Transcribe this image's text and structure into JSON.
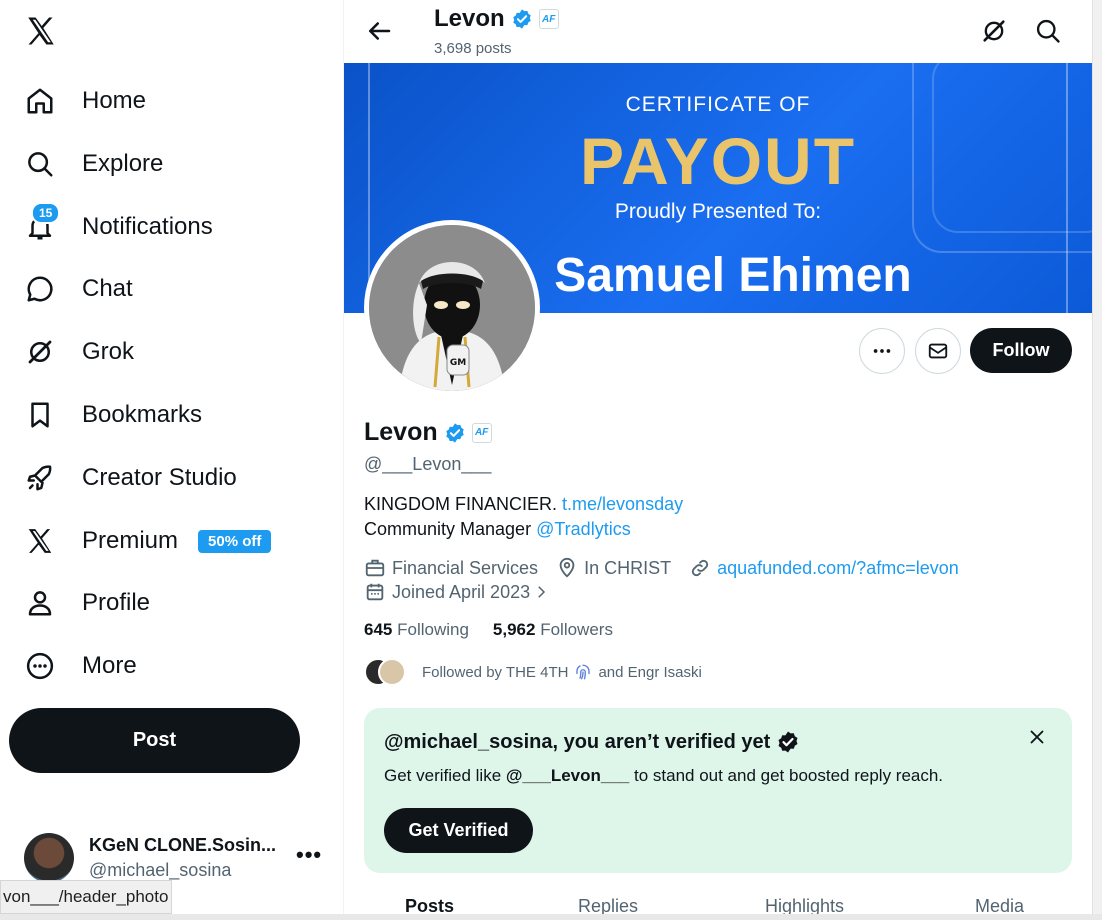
{
  "nav": {
    "items": [
      {
        "label": "Home",
        "icon": "home-icon"
      },
      {
        "label": "Explore",
        "icon": "search-icon"
      },
      {
        "label": "Notifications",
        "icon": "bell-icon",
        "badge": "15"
      },
      {
        "label": "Chat",
        "icon": "chat-bubble-icon"
      },
      {
        "label": "Grok",
        "icon": "grok-icon"
      },
      {
        "label": "Bookmarks",
        "icon": "bookmark-icon"
      },
      {
        "label": "Creator Studio",
        "icon": "rocket-icon"
      },
      {
        "label": "Premium",
        "icon": "x-logo-icon",
        "promo": "50% off"
      },
      {
        "label": "Profile",
        "icon": "person-icon"
      },
      {
        "label": "More",
        "icon": "more-circle-icon"
      }
    ],
    "post_label": "Post",
    "account": {
      "name": "KGeN CLONE.Sosin...",
      "handle": "@michael_sosina"
    },
    "status_url": "von___/header_photo"
  },
  "header": {
    "name": "Levon",
    "posts_count": "3,698 posts",
    "affiliate_badge": "AF"
  },
  "banner": {
    "line1": "CERTIFICATE OF",
    "line2": "PAYOUT",
    "line3": "Proudly Presented To:",
    "line4": "Samuel Ehimen"
  },
  "profile": {
    "name": "Levon",
    "handle": "@___Levon___",
    "bio_line1": "KINGDOM FINANCIER.",
    "bio_link1": "t.me/levonsday",
    "bio_line2": "Community Manager",
    "bio_link2": "@Tradlytics",
    "category": "Financial Services",
    "location": "In CHRIST",
    "website": "aquafunded.com/?afmc=levon",
    "joined": "Joined April 2023",
    "following_count": "645",
    "following_label": "Following",
    "followers_count": "5,962",
    "followers_label": "Followers",
    "followed_by": "Followed by THE 4TH",
    "followed_by_rest": "and Engr Isaski",
    "follow_label": "Follow"
  },
  "verify_card": {
    "title": "@michael_sosina, you aren’t verified yet",
    "desc_pre": "Get verified like ",
    "desc_handle": "@___Levon___",
    "desc_post": " to stand out and get boosted reply reach.",
    "button": "Get Verified"
  },
  "tabs": [
    "Posts",
    "Replies",
    "Highlights",
    "Media"
  ],
  "colors": {
    "accent": "#1d9bf0",
    "button_dark": "#0f1419",
    "verify_bg": "#def5ea",
    "banner_blue": "#1a6ef0",
    "payout_gold": "#e9c46a"
  }
}
